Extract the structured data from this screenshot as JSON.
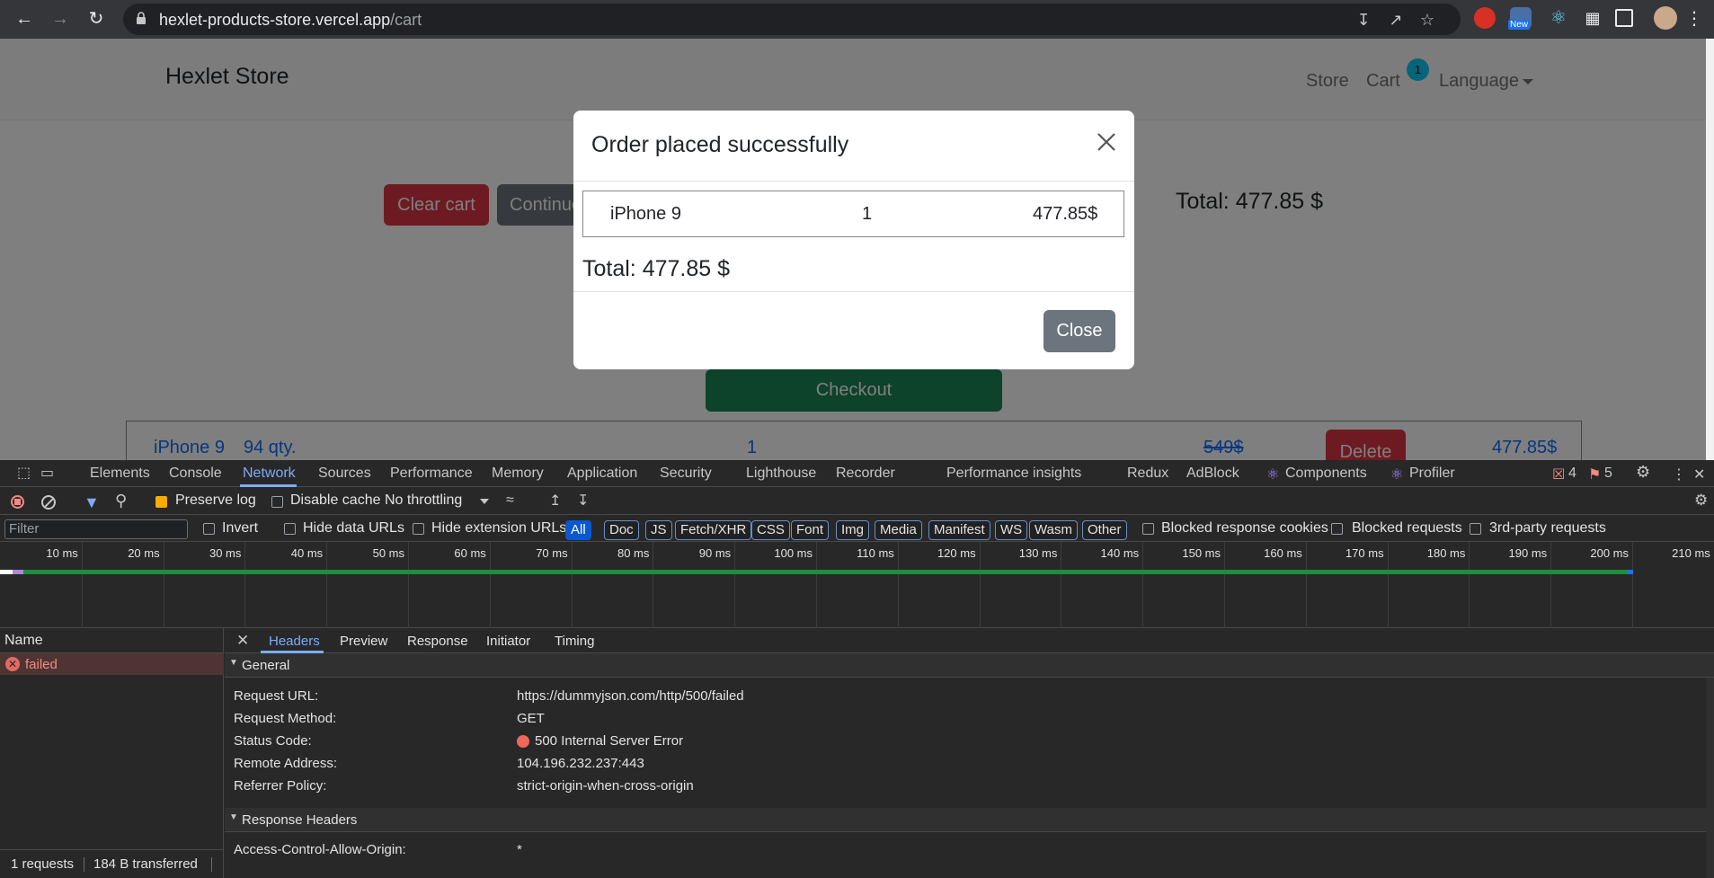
{
  "browser": {
    "url_host": "hexlet-products-store.vercel.app",
    "url_path": "/cart",
    "new_badge": "New"
  },
  "page": {
    "brand": "Hexlet Store",
    "nav": {
      "store": "Store",
      "cart": "Cart",
      "cart_count": "1",
      "language": "Language"
    },
    "clear_cart": "Clear cart",
    "continue": "Continue shopping",
    "total": "Total: 477.85 $",
    "checkout": "Checkout",
    "cart_row": {
      "name": "iPhone 9",
      "qty": "94 qty.",
      "count": "1",
      "old_price": "549$",
      "delete": "Delete",
      "price": "477.85$"
    }
  },
  "modal": {
    "title": "Order placed successfully",
    "item": {
      "name": "iPhone 9",
      "qty": "1",
      "price": "477.85$"
    },
    "total": "Total: 477.85 $",
    "close": "Close"
  },
  "devtools": {
    "tabs": [
      "Elements",
      "Console",
      "Network",
      "Sources",
      "Performance",
      "Memory",
      "Application",
      "Security",
      "Lighthouse",
      "Recorder",
      "Performance insights",
      "Redux",
      "AdBlock",
      "Components",
      "Profiler"
    ],
    "errors": "4",
    "warnings": "5",
    "preserve_log": "Preserve log",
    "disable_cache": "Disable cache",
    "throttling": "No throttling",
    "filter_placeholder": "Filter",
    "invert": "Invert",
    "hide_data_urls": "Hide data URLs",
    "hide_extension_urls": "Hide extension URLs",
    "type_filters": [
      "All",
      "Doc",
      "JS",
      "Fetch/XHR",
      "CSS",
      "Font",
      "Img",
      "Media",
      "Manifest",
      "WS",
      "Wasm",
      "Other"
    ],
    "blocked_response_cookies": "Blocked response cookies",
    "blocked_requests": "Blocked requests",
    "third_party": "3rd-party requests",
    "timeline_ticks": [
      "10 ms",
      "20 ms",
      "30 ms",
      "40 ms",
      "50 ms",
      "60 ms",
      "70 ms",
      "80 ms",
      "90 ms",
      "100 ms",
      "110 ms",
      "120 ms",
      "130 ms",
      "140 ms",
      "150 ms",
      "160 ms",
      "170 ms",
      "180 ms",
      "190 ms",
      "200 ms",
      "210 ms"
    ],
    "name_header": "Name",
    "request_name": "failed",
    "detail_tabs": [
      "Headers",
      "Preview",
      "Response",
      "Initiator",
      "Timing"
    ],
    "general_title": "General",
    "general": [
      {
        "k": "Request URL:",
        "v": "https://dummyjson.com/http/500/failed"
      },
      {
        "k": "Request Method:",
        "v": "GET"
      },
      {
        "k": "Status Code:",
        "v": "500 Internal Server Error"
      },
      {
        "k": "Remote Address:",
        "v": "104.196.232.237:443"
      },
      {
        "k": "Referrer Policy:",
        "v": "strict-origin-when-cross-origin"
      }
    ],
    "response_headers_title": "Response Headers",
    "response_headers": [
      {
        "k": "Access-Control-Allow-Origin:",
        "v": "*"
      }
    ],
    "footer_requests": "1 requests",
    "footer_transferred": "184 B transferred"
  },
  "colors": {
    "danger": "#dc3545",
    "secondary": "#6c757d",
    "success": "#198754",
    "link": "#0d6efd",
    "devtools_accent": "#7cacf8"
  }
}
